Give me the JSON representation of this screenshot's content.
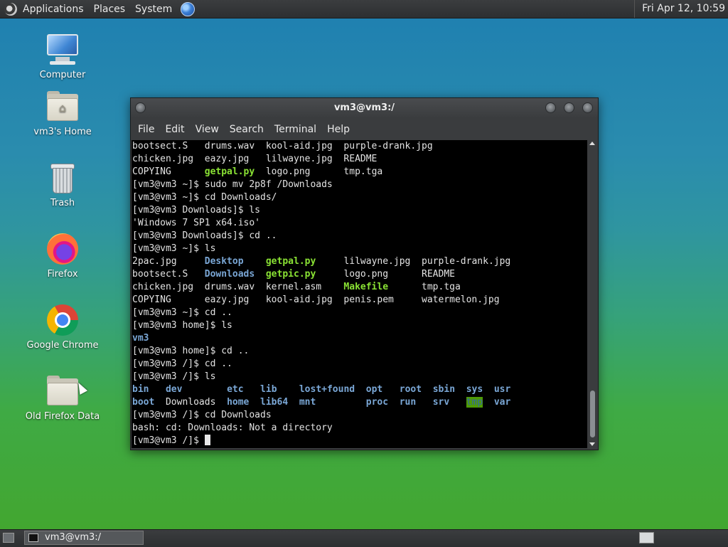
{
  "top_panel": {
    "menus": [
      "Applications",
      "Places",
      "System"
    ],
    "clock": "Fri Apr 12, 10:59",
    "icons": [
      "menu-logo-icon",
      "globe-icon"
    ]
  },
  "desktop_icons": [
    {
      "label": "Computer",
      "icon": "computer-icon"
    },
    {
      "label": "vm3's Home",
      "icon": "home-folder-icon"
    },
    {
      "label": "Trash",
      "icon": "trash-icon"
    },
    {
      "label": "Firefox",
      "icon": "firefox-icon"
    },
    {
      "label": "Google Chrome",
      "icon": "chrome-icon"
    },
    {
      "label": "Old Firefox Data",
      "icon": "folder-icon"
    }
  ],
  "terminal": {
    "title": "vm3@vm3:/",
    "menu": [
      "File",
      "Edit",
      "View",
      "Search",
      "Terminal",
      "Help"
    ],
    "lines": [
      [
        {
          "t": "bootsect.S   drums.wav  kool-aid.jpg  purple-drank.jpg"
        }
      ],
      [
        {
          "t": "chicken.jpg  eazy.jpg   lilwayne.jpg  README"
        }
      ],
      [
        {
          "t": "COPYING      "
        },
        {
          "t": "getpal.py",
          "c": "exe"
        },
        {
          "t": "  logo.png      tmp.tga"
        }
      ],
      [
        {
          "t": "[vm3@vm3 ~]$ sudo mv 2p8f /Downloads"
        }
      ],
      [
        {
          "t": "[vm3@vm3 ~]$ cd Downloads/"
        }
      ],
      [
        {
          "t": "[vm3@vm3 Downloads]$ ls"
        }
      ],
      [
        {
          "t": "'Windows 7 SP1 x64.iso'"
        }
      ],
      [
        {
          "t": "[vm3@vm3 Downloads]$ cd .."
        }
      ],
      [
        {
          "t": "[vm3@vm3 ~]$ ls"
        }
      ],
      [
        {
          "t": "2pac.jpg     "
        },
        {
          "t": "Desktop",
          "c": "dir"
        },
        {
          "t": "    "
        },
        {
          "t": "getpal.py",
          "c": "exe"
        },
        {
          "t": "     lilwayne.jpg  purple-drank.jpg"
        }
      ],
      [
        {
          "t": "bootsect.S   "
        },
        {
          "t": "Downloads",
          "c": "dir"
        },
        {
          "t": "  "
        },
        {
          "t": "getpic.py",
          "c": "exe"
        },
        {
          "t": "     logo.png      README"
        }
      ],
      [
        {
          "t": "chicken.jpg  drums.wav  kernel.asm    "
        },
        {
          "t": "Makefile",
          "c": "exe"
        },
        {
          "t": "      tmp.tga"
        }
      ],
      [
        {
          "t": "COPYING      eazy.jpg   kool-aid.jpg  penis.pem     watermelon.jpg"
        }
      ],
      [
        {
          "t": "[vm3@vm3 ~]$ cd .."
        }
      ],
      [
        {
          "t": "[vm3@vm3 home]$ ls"
        }
      ],
      [
        {
          "t": "vm3",
          "c": "dir"
        }
      ],
      [
        {
          "t": "[vm3@vm3 home]$ cd .."
        }
      ],
      [
        {
          "t": "[vm3@vm3 /]$ cd .."
        }
      ],
      [
        {
          "t": "[vm3@vm3 /]$ ls"
        }
      ],
      [
        {
          "t": "bin",
          "c": "dir"
        },
        {
          "t": "   "
        },
        {
          "t": "dev",
          "c": "dir"
        },
        {
          "t": "        "
        },
        {
          "t": "etc",
          "c": "dir"
        },
        {
          "t": "   "
        },
        {
          "t": "lib",
          "c": "dir"
        },
        {
          "t": "    "
        },
        {
          "t": "lost+found",
          "c": "dir"
        },
        {
          "t": "  "
        },
        {
          "t": "opt",
          "c": "dir"
        },
        {
          "t": "   "
        },
        {
          "t": "root",
          "c": "dir"
        },
        {
          "t": "  "
        },
        {
          "t": "sbin",
          "c": "dir"
        },
        {
          "t": "  "
        },
        {
          "t": "sys",
          "c": "dir"
        },
        {
          "t": "  "
        },
        {
          "t": "usr",
          "c": "dir"
        }
      ],
      [
        {
          "t": "boot",
          "c": "dir"
        },
        {
          "t": "  Downloads  "
        },
        {
          "t": "home",
          "c": "dir"
        },
        {
          "t": "  "
        },
        {
          "t": "lib64",
          "c": "dir"
        },
        {
          "t": "  "
        },
        {
          "t": "mnt",
          "c": "dir"
        },
        {
          "t": "         "
        },
        {
          "t": "proc",
          "c": "dir"
        },
        {
          "t": "  "
        },
        {
          "t": "run",
          "c": "dir"
        },
        {
          "t": "   "
        },
        {
          "t": "srv",
          "c": "dir"
        },
        {
          "t": "   "
        },
        {
          "t": "tmp",
          "c": "sticky"
        },
        {
          "t": "  "
        },
        {
          "t": "var",
          "c": "dir"
        }
      ],
      [
        {
          "t": "[vm3@vm3 /]$ cd Downloads"
        }
      ],
      [
        {
          "t": "bash: cd: Downloads: Not a directory"
        }
      ],
      [
        {
          "t": "[vm3@vm3 /]$ "
        }
      ]
    ]
  },
  "taskbar": {
    "items": [
      {
        "label": "vm3@vm3:/",
        "icon": "terminal-icon"
      }
    ],
    "icons": [
      "show-desktop-icon",
      "workspace-switcher-icon"
    ]
  }
}
